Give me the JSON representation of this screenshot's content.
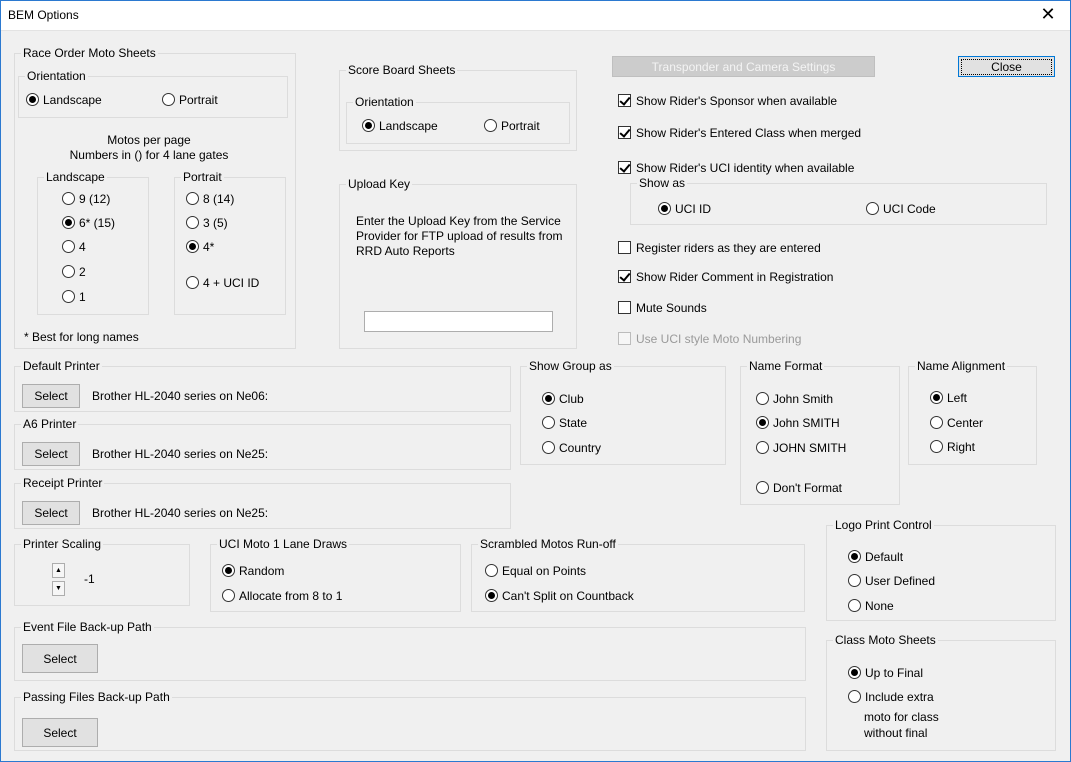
{
  "window": {
    "title": "BEM Options",
    "close_glyph": "✕"
  },
  "race_order": {
    "legend": "Race Order Moto Sheets",
    "orientation_legend": "Orientation",
    "landscape": "Landscape",
    "portrait": "Portrait",
    "motos_line1": "Motos per page",
    "motos_line2": "Numbers in () for 4 lane gates",
    "landscape_group": "Landscape",
    "landscape_options": [
      "9  (12)",
      "6*  (15)",
      "4",
      "2",
      "1"
    ],
    "portrait_group": "Portrait",
    "portrait_options": [
      "8  (14)",
      "3  (5)",
      "4*",
      "4 + UCI ID"
    ],
    "footnote": "* Best for long names"
  },
  "score_board": {
    "legend": "Score Board Sheets",
    "orientation_legend": "Orientation",
    "landscape": "Landscape",
    "portrait": "Portrait"
  },
  "upload_key": {
    "legend": "Upload Key",
    "description": "Enter the Upload Key from the Service Provider for FTP upload of results from RRD Auto Reports",
    "value": ""
  },
  "buttons": {
    "transponder": "Transponder and Camera Settings",
    "close": "Close",
    "select": "Select"
  },
  "options": {
    "sponsor": "Show Rider's Sponsor when available",
    "entered_class": "Show Rider's Entered Class when merged",
    "uci_identity": "Show Rider's UCI identity when available",
    "show_as_legend": "Show as",
    "uci_id": "UCI ID",
    "uci_code": "UCI Code",
    "register": "Register riders as they are entered",
    "comment": "Show Rider Comment in Registration",
    "mute": "Mute Sounds",
    "uci_numbering": "Use UCI style Moto Numbering"
  },
  "printers": {
    "default_legend": "Default Printer",
    "default_value": "Brother HL-2040 series on Ne06:",
    "a6_legend": "A6 Printer",
    "a6_value": "Brother HL-2040 series on Ne25:",
    "receipt_legend": "Receipt Printer",
    "receipt_value": "Brother HL-2040 series on Ne25:"
  },
  "show_group": {
    "legend": "Show Group as",
    "options": [
      "Club",
      "State",
      "Country"
    ]
  },
  "name_format": {
    "legend": "Name Format",
    "options": [
      "John Smith",
      "John SMITH",
      "JOHN SMITH",
      "Don't Format"
    ]
  },
  "name_alignment": {
    "legend": "Name Alignment",
    "options": [
      "Left",
      "Center",
      "Right"
    ]
  },
  "printer_scaling": {
    "legend": "Printer Scaling",
    "value": "-1"
  },
  "uci_lane": {
    "legend": "UCI Moto 1 Lane Draws",
    "options": [
      "Random",
      "Allocate from 8 to 1"
    ]
  },
  "scrambled": {
    "legend": "Scrambled Motos Run-off",
    "options": [
      "Equal on Points",
      "Can't Split on Countback"
    ]
  },
  "logo": {
    "legend": "Logo Print Control",
    "options": [
      "Default",
      "User Defined",
      "None"
    ]
  },
  "event_backup": {
    "legend": "Event File Back-up Path"
  },
  "passing_backup": {
    "legend": "Passing Files Back-up Path"
  },
  "class_moto": {
    "legend": "Class Moto Sheets",
    "options": [
      "Up to Final",
      "Include extra",
      "moto for class",
      "without final"
    ]
  }
}
